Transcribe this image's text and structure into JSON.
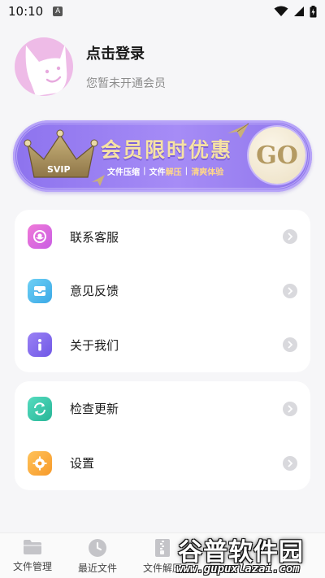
{
  "status_bar": {
    "time": "10:10",
    "notification_badge": "A"
  },
  "profile": {
    "title": "点击登录",
    "subtitle": "您暂未开通会员"
  },
  "vip_banner": {
    "crown_label": "SVIP",
    "headline": "会员限时优惠",
    "features": [
      "文件压缩",
      "文件解压",
      "清爽体验"
    ],
    "separator": "|",
    "go_label": "GO"
  },
  "menu": {
    "group1": [
      {
        "label": "联系客服",
        "icon": "customer-service-icon"
      },
      {
        "label": "意见反馈",
        "icon": "feedback-icon"
      },
      {
        "label": "关于我们",
        "icon": "info-icon"
      }
    ],
    "group2": [
      {
        "label": "检查更新",
        "icon": "refresh-icon"
      },
      {
        "label": "设置",
        "icon": "settings-icon"
      }
    ]
  },
  "bottom_nav": [
    {
      "label": "文件管理",
      "icon": "folder-icon"
    },
    {
      "label": "最近文件",
      "icon": "clock-icon"
    },
    {
      "label": "文件解压",
      "icon": "zip-icon"
    }
  ],
  "watermark": {
    "title": "谷普软件园",
    "url": "www.gupuxlazai.com"
  },
  "colors": {
    "banner": "#9a80f2",
    "headline": "#f6e2a4",
    "go": "#b49a62",
    "avatar_bg": "#eebbe7"
  }
}
